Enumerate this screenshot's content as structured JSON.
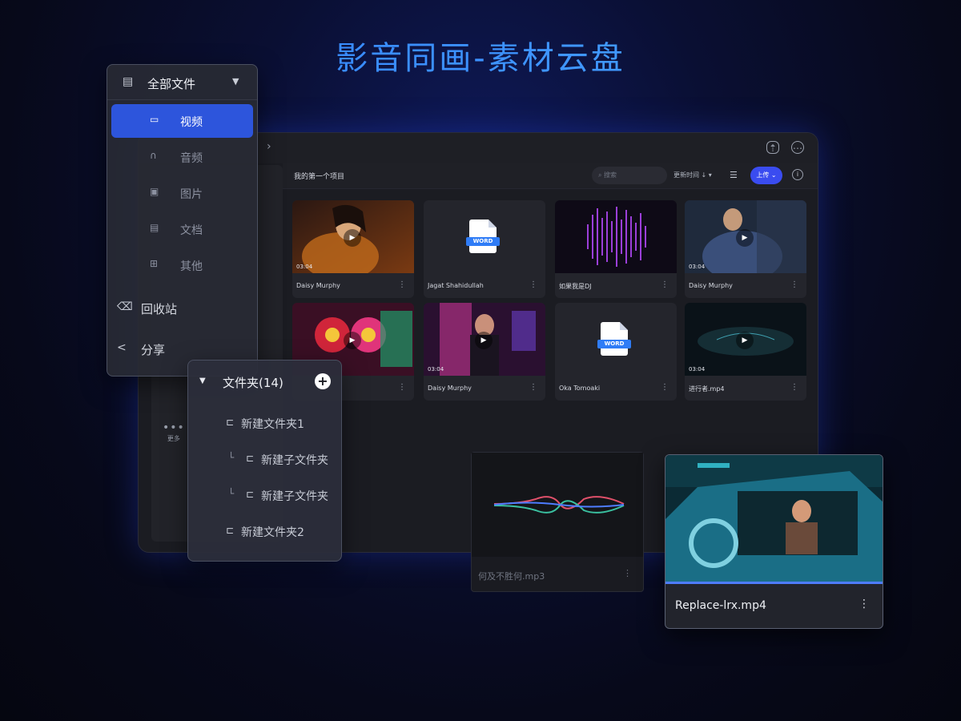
{
  "hero": {
    "title": "影音同画-素材云盘"
  },
  "window": {
    "nav_forward": "›",
    "more_label": "更多",
    "header": {
      "project": "我的第一个项目",
      "search_placeholder": "搜索",
      "sort": "更新时间 ↓ ▾",
      "upload": "上传 ⌄"
    }
  },
  "cards": [
    {
      "name": "Daisy Murphy",
      "duration": "03:04",
      "type": "video"
    },
    {
      "name": "Jagat Shahidullah",
      "type": "doc",
      "badge": "WORD"
    },
    {
      "name": "如果我是DJ",
      "type": "audio"
    },
    {
      "name": "Daisy Murphy",
      "duration": "03:04",
      "type": "video"
    },
    {
      "name": "",
      "type": "video"
    },
    {
      "name": "Daisy Murphy",
      "duration": "03:04",
      "type": "video"
    },
    {
      "name": "Oka Tomoaki",
      "type": "doc",
      "badge": "WORD"
    },
    {
      "name": "进行者.mp4",
      "duration": "03:04",
      "type": "video"
    }
  ],
  "category_panel": {
    "header": "全部文件",
    "items": [
      {
        "label": "视频",
        "active": true
      },
      {
        "label": "音频"
      },
      {
        "label": "图片"
      },
      {
        "label": "文档"
      },
      {
        "label": "其他"
      }
    ],
    "recycle": "回收站",
    "share": "分享"
  },
  "folder_panel": {
    "header": "文件夹(14)",
    "folders": [
      {
        "label": "新建文件夹1"
      },
      {
        "label": "新建子文件夹"
      },
      {
        "label": "新建子文件夹"
      },
      {
        "label": "新建文件夹2"
      }
    ]
  },
  "audio_card": {
    "name": "何及不胜何.mp3"
  },
  "video_card": {
    "name": "Replace-lrx.mp4",
    "progress": 1.0
  },
  "colors": {
    "accent": "#2d55dc",
    "upload": "#3a4cf0",
    "title": "#2f7cff"
  }
}
